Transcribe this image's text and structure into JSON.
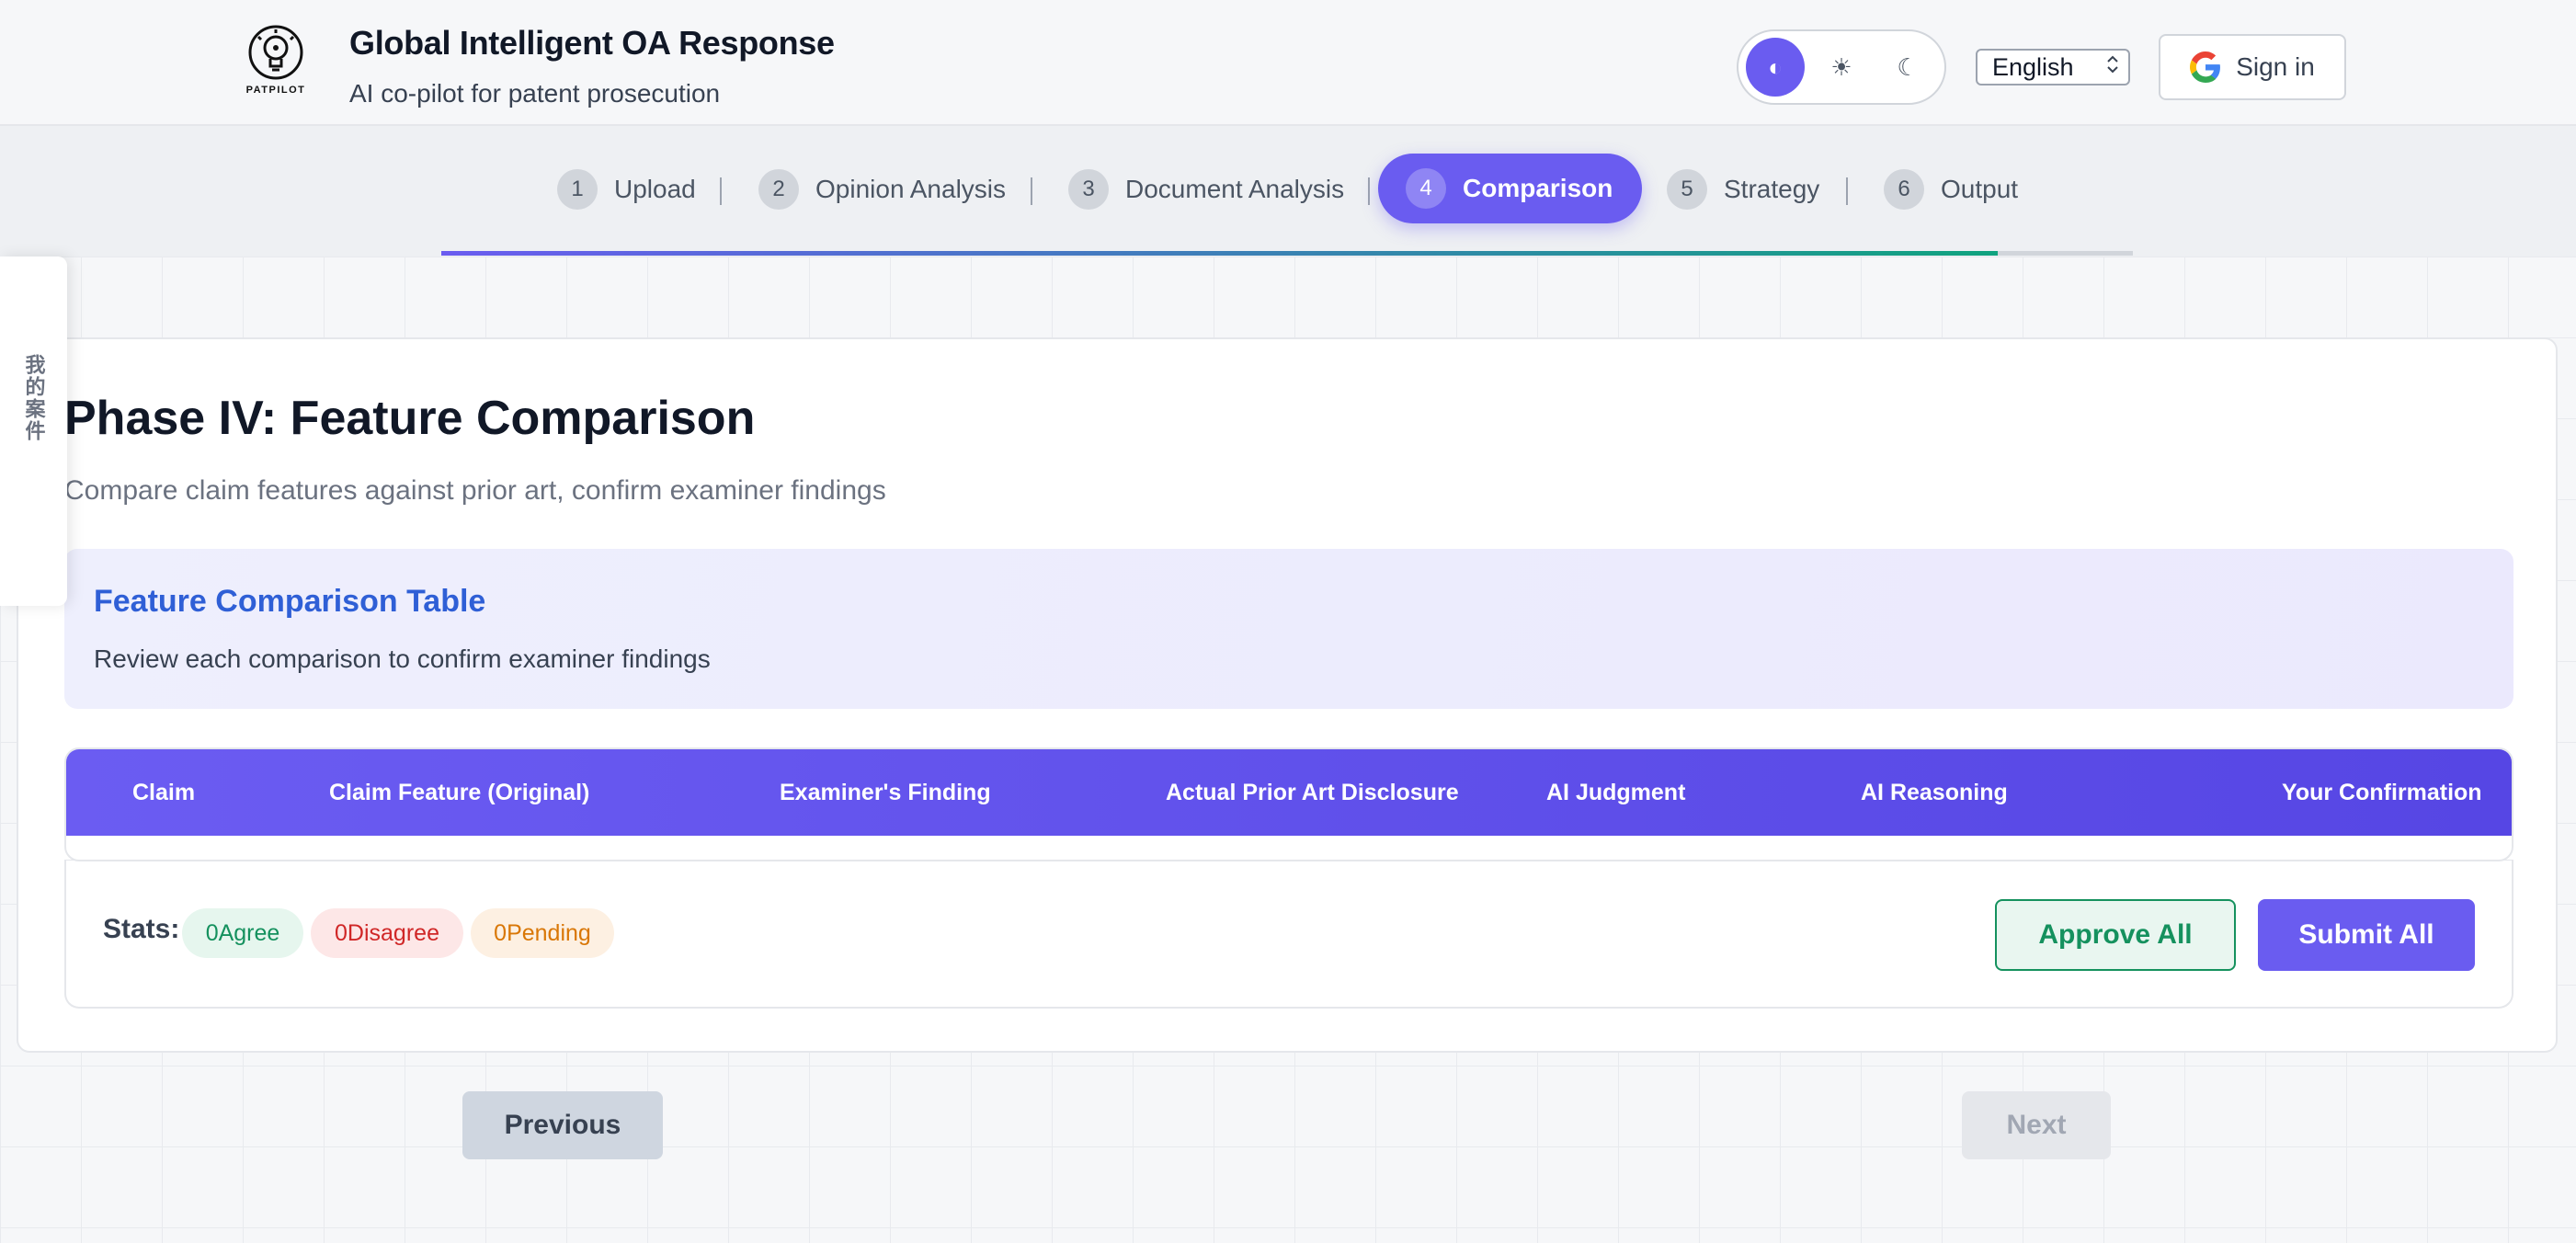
{
  "header": {
    "logo_text": "PATPILOT",
    "title": "Global Intelligent OA Response",
    "subtitle": "AI co-pilot for patent prosecution",
    "theme_toggle": {
      "options": [
        "auto-theme-icon",
        "sun-icon",
        "moon-icon"
      ],
      "active": "auto-theme-icon"
    },
    "language": "English",
    "signin_label": "Sign in"
  },
  "stepper": {
    "steps": [
      {
        "num": "1",
        "label": "Upload"
      },
      {
        "num": "2",
        "label": "Opinion Analysis"
      },
      {
        "num": "3",
        "label": "Document Analysis"
      },
      {
        "num": "4",
        "label": "Comparison"
      },
      {
        "num": "5",
        "label": "Strategy"
      },
      {
        "num": "6",
        "label": "Output"
      }
    ],
    "active_step": 4,
    "progress_fraction": 0.92
  },
  "side_tab": {
    "label": "我的案件"
  },
  "main": {
    "title": "Phase IV: Feature Comparison",
    "description": "Compare claim features against prior art, confirm examiner findings",
    "info": {
      "title": "Feature Comparison Table",
      "description": "Review each comparison to confirm examiner findings"
    },
    "table": {
      "columns": [
        "Claim",
        "Claim Feature (Original)",
        "Examiner's Finding",
        "Actual Prior Art Disclosure",
        "AI Judgment",
        "AI Reasoning",
        "Your Confirmation"
      ],
      "rows": []
    },
    "stats": {
      "label": "Stats:",
      "agree": "0Agree",
      "disagree": "0Disagree",
      "pending": "0Pending"
    },
    "approve_all_label": "Approve All",
    "submit_all_label": "Submit All"
  },
  "nav": {
    "previous_label": "Previous",
    "next_label": "Next"
  },
  "colors": {
    "accent": "#6a5cf0",
    "agree": "#15915e",
    "disagree": "#d02727",
    "pending": "#d97706",
    "info_title": "#2f5fd6"
  }
}
